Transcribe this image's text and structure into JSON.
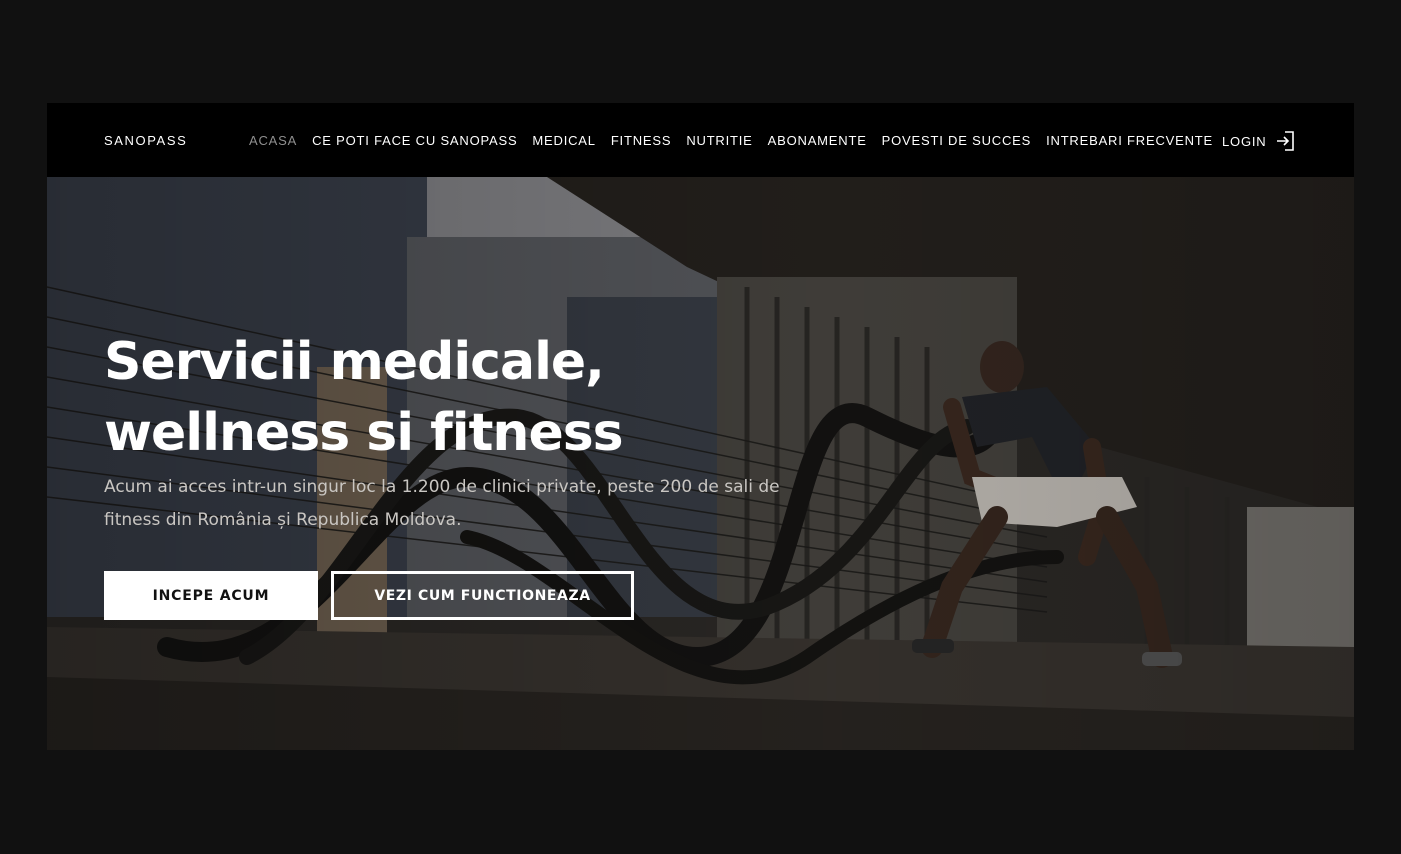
{
  "brand": {
    "logo": "SANOPASS"
  },
  "nav": {
    "items": [
      {
        "label": "ACASA",
        "active": true
      },
      {
        "label": "CE POTI FACE CU SANOPASS",
        "active": false
      },
      {
        "label": "MEDICAL",
        "active": false
      },
      {
        "label": "FITNESS",
        "active": false
      },
      {
        "label": "NUTRITIE",
        "active": false
      },
      {
        "label": "ABONAMENTE",
        "active": false
      },
      {
        "label": "POVESTI DE SUCCES",
        "active": false
      },
      {
        "label": "INTREBARI FRECVENTE",
        "active": false
      }
    ],
    "login_label": "LOGIN",
    "login_icon": "login-arrow-icon"
  },
  "hero": {
    "title": "Servicii medicale, wellness si fitness",
    "subtitle": "Acum ai acces intr-un singur loc la 1.200 de clinici private,  peste 200 de sali de fitness din România și Republica Moldova.",
    "primary_cta": "INCEPE ACUM",
    "secondary_cta": "VEZI CUM FUNCTIONEAZA",
    "image": "battle-ropes-athlete-photo"
  },
  "colors": {
    "page_bg": "#111111",
    "nav_bg": "#000000",
    "nav_active": "#8f8f8f",
    "text": "#ffffff",
    "subtitle": "#c9c6c2"
  }
}
